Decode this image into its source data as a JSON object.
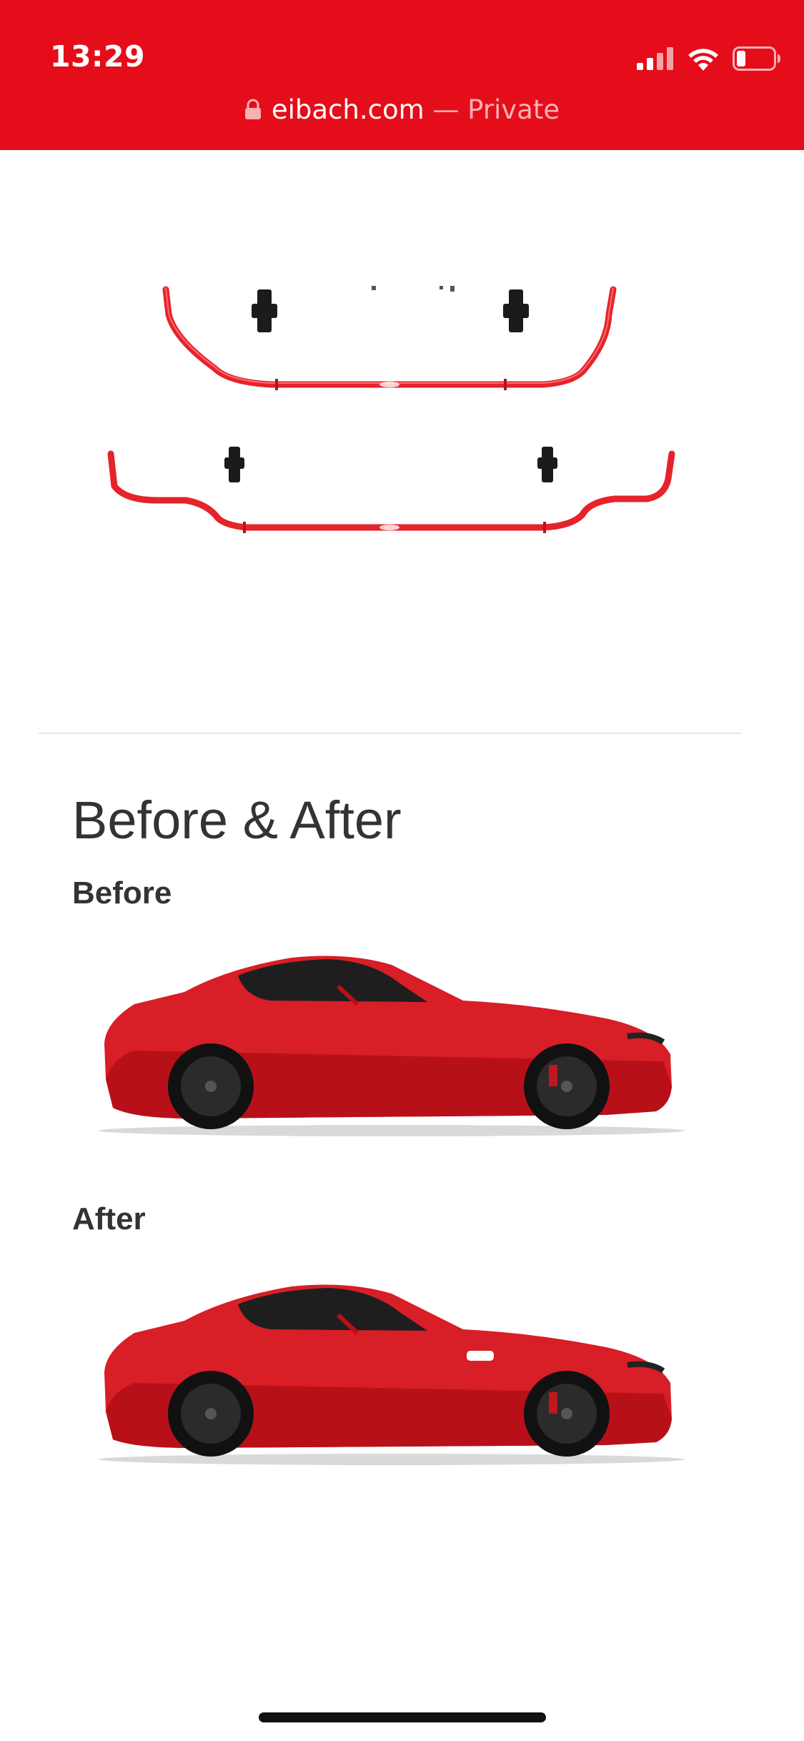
{
  "status_bar": {
    "time": "13:29",
    "icons": [
      "cellular-signal-icon",
      "wifi-icon",
      "battery-icon"
    ]
  },
  "address_bar": {
    "domain": "eibach.com",
    "separator": " — ",
    "mode": "Private",
    "icon": "lock-icon"
  },
  "product_images": [
    {
      "name": "front-anti-roll-bar",
      "color": "#e5232b"
    },
    {
      "name": "rear-anti-roll-bar",
      "color": "#e5232b"
    }
  ],
  "before_after": {
    "title": "Before & After",
    "before_label": "Before",
    "after_label": "After"
  },
  "colors": {
    "brand_red": "#e50d1a",
    "car_red": "#d81e26",
    "text": "#333333"
  }
}
